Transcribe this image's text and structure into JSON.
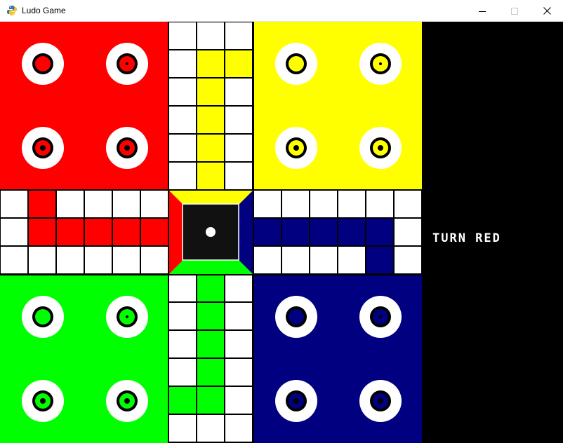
{
  "window": {
    "title": "Ludo Game",
    "icon": "python-icon",
    "controls": [
      "minimize-icon",
      "maximize-icon",
      "close-icon"
    ]
  },
  "status": {
    "turn_label": "TURN RED"
  },
  "colors": {
    "red": "#ff0000",
    "yellow": "#ffff00",
    "green": "#00ff00",
    "blue": "#000080",
    "panel": "#000000",
    "center": "#111111",
    "grid_line": "#000000",
    "cell": "#ffffff"
  },
  "board": {
    "players": [
      "red",
      "yellow",
      "green",
      "blue"
    ],
    "pieces_per_player": 4,
    "pieces_at_home": {
      "red": 4,
      "yellow": 4,
      "green": 4,
      "blue": 4
    },
    "die": {
      "pips": 1
    }
  }
}
